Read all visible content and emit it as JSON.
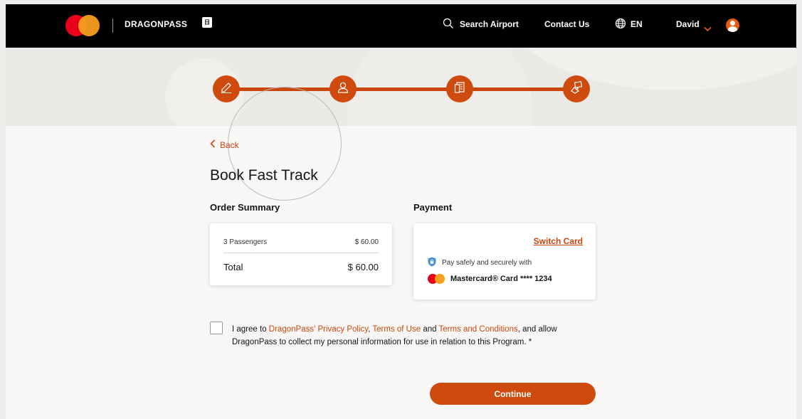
{
  "header": {
    "brand": "DRAGONPASS",
    "brand_badge": "日常",
    "nav": {
      "search_label": "Search Airport",
      "contact_label": "Contact Us",
      "language_label": "EN",
      "user_label": "David"
    }
  },
  "progress": {
    "steps": [
      "edit",
      "passenger",
      "review",
      "confirmation"
    ],
    "current_step": 3,
    "total_steps": 4
  },
  "main": {
    "back_label": "Back",
    "title": "Book Fast Track",
    "order_summary": {
      "heading": "Order Summary",
      "line_item_label": "3 Passengers",
      "line_item_value": "$ 60.00",
      "total_label": "Total",
      "total_value": "$ 60.00"
    },
    "payment": {
      "heading": "Payment",
      "switch_card_label": "Switch Card",
      "secure_text": "Pay safely and securely with",
      "card_text": "Mastercard® Card **** 1234"
    },
    "consent": {
      "prefix": "I agree to ",
      "privacy_link": "DragonPass' Privacy Policy",
      "sep1": ", ",
      "terms_use_link": "Terms of Use",
      "sep2": " and ",
      "terms_conditions_link": "Terms and Conditions",
      "suffix": ", and allow DragonPass to collect my personal information for use in relation to this Program. *"
    },
    "continue_label": "Continue"
  },
  "colors": {
    "accent": "#cf4a0d",
    "header_bg": "#000000",
    "page_bg": "#f8f7f5",
    "band_bg": "#ebe9e6"
  }
}
